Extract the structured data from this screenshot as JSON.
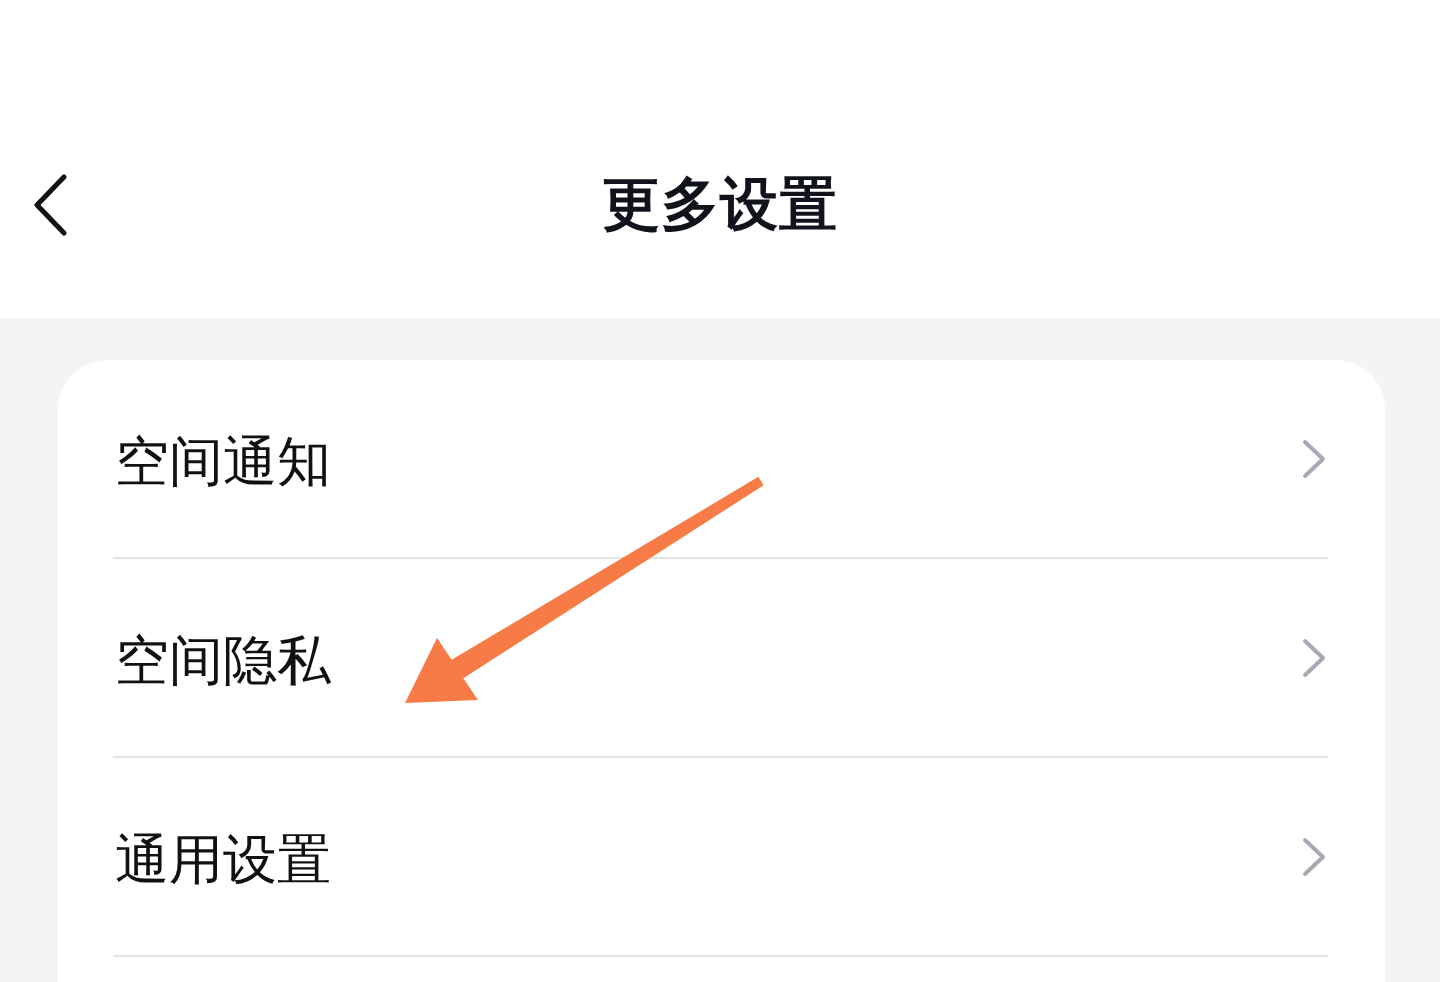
{
  "header": {
    "title": "更多设置"
  },
  "rows": [
    {
      "label": "空间通知",
      "marked": false
    },
    {
      "label": "空间隐私",
      "marked": true
    },
    {
      "label": "通用设置",
      "marked": false
    }
  ]
}
